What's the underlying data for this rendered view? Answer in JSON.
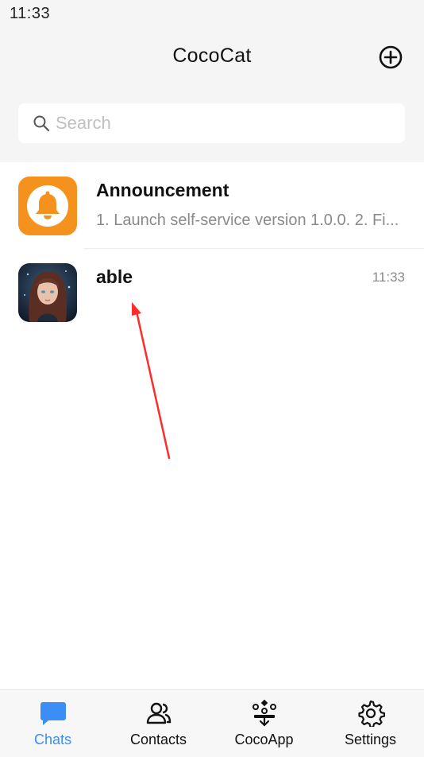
{
  "status_bar": {
    "time": "11:33"
  },
  "header": {
    "title": "CocoCat",
    "add_icon": "plus-circle-icon"
  },
  "search": {
    "placeholder": "Search",
    "value": ""
  },
  "chats": [
    {
      "name": "Announcement",
      "preview": "1. Launch self-service version 1.0.0. 2. Fi...",
      "time": "",
      "avatar": "bell-icon",
      "avatar_color": "#F5921E"
    },
    {
      "name": "able",
      "preview": "",
      "time": "11:33",
      "avatar": "user-portrait"
    }
  ],
  "tabbar": {
    "active": "Chats",
    "active_color": "#3A8EF6",
    "tabs": [
      {
        "label": "Chats",
        "icon": "chat-bubble-icon"
      },
      {
        "label": "Contacts",
        "icon": "contacts-icon"
      },
      {
        "label": "CocoApp",
        "icon": "cocoapp-icon"
      },
      {
        "label": "Settings",
        "icon": "gear-icon"
      }
    ]
  }
}
